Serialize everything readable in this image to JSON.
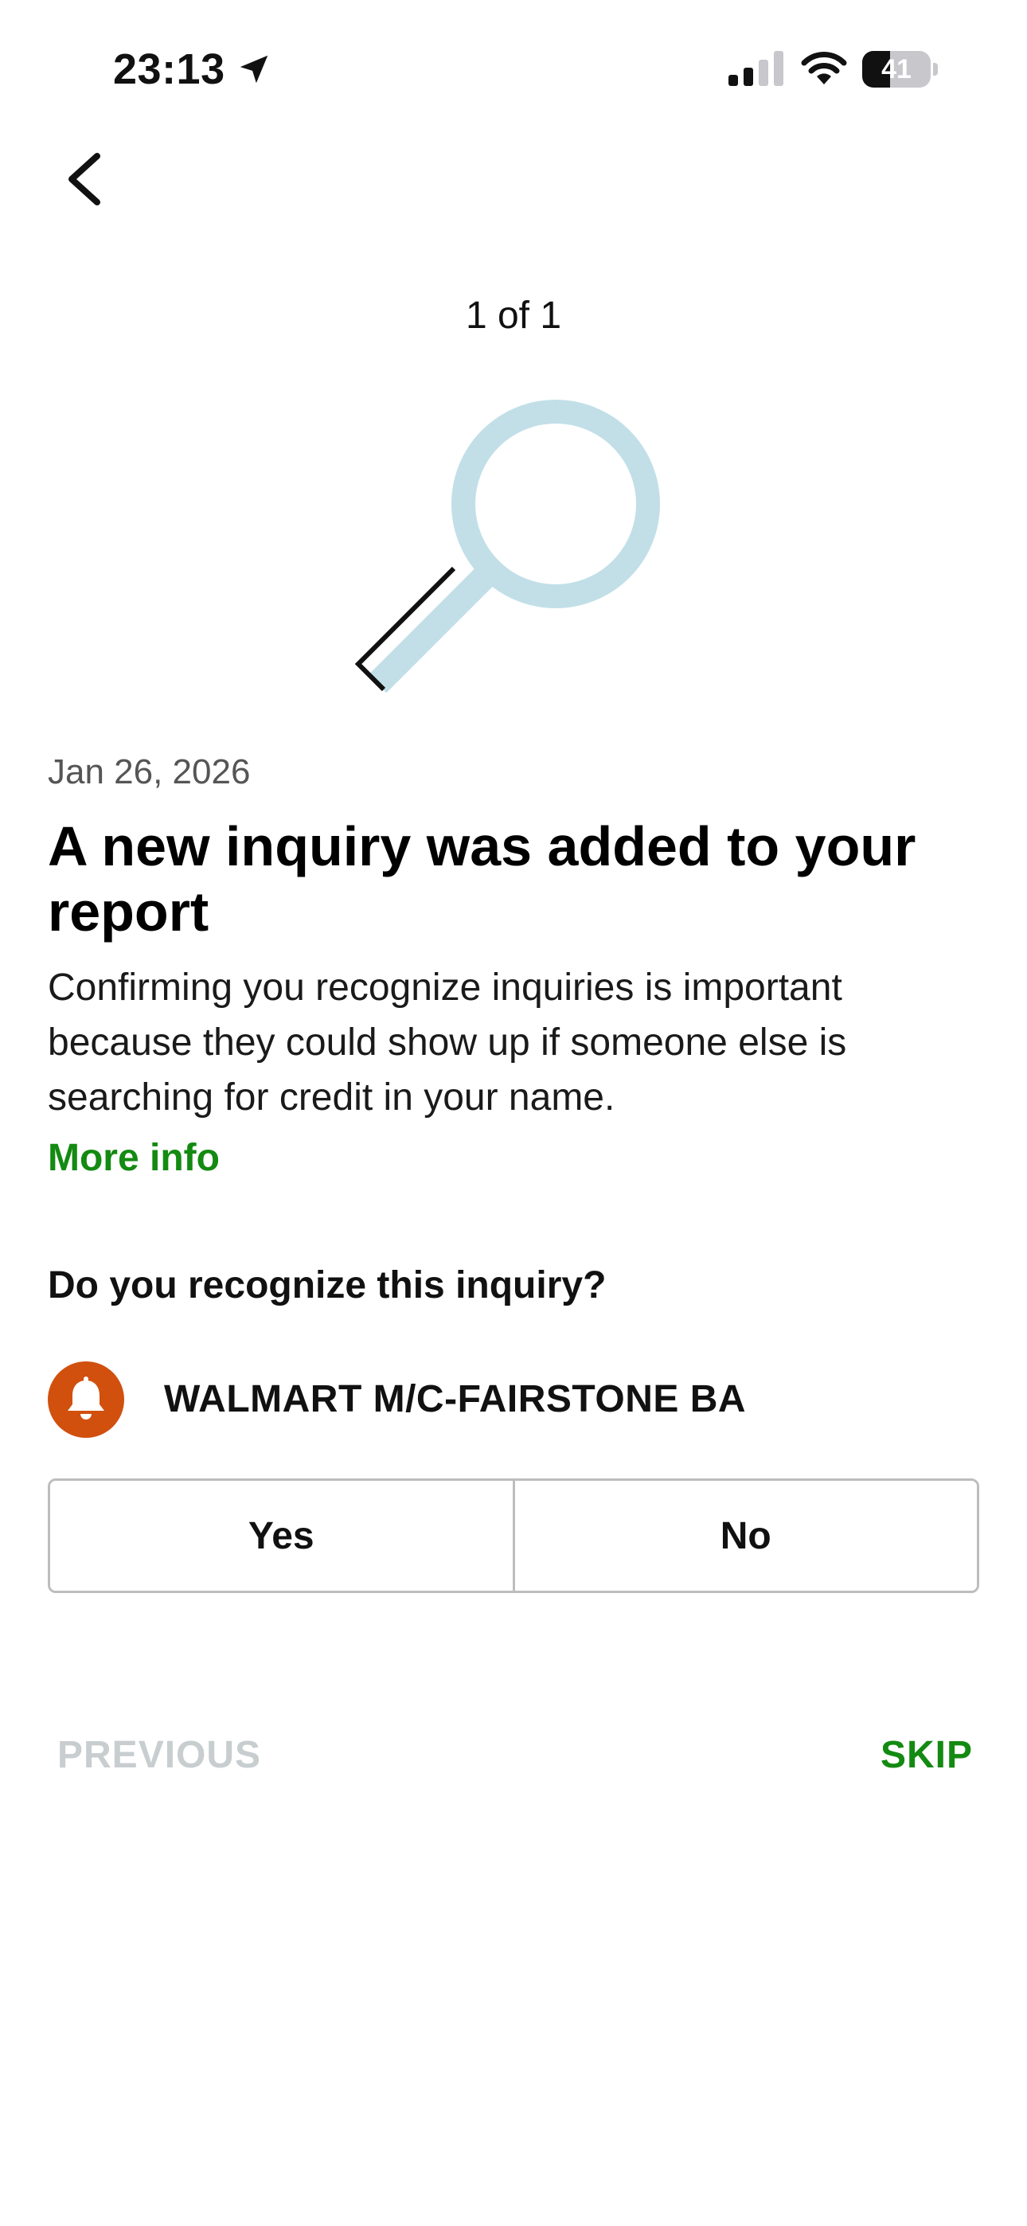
{
  "status_bar": {
    "time": "23:13",
    "location_icon": "location-arrow-icon",
    "signal_icon": "cellular-signal-icon",
    "signal_bars_active": 2,
    "signal_bars_total": 4,
    "wifi_icon": "wifi-icon",
    "battery_icon": "battery-icon",
    "battery_level": "41"
  },
  "nav": {
    "back_icon": "chevron-left-icon"
  },
  "pager": {
    "label": "1 of 1"
  },
  "hero": {
    "icon": "magnifying-glass-icon",
    "color": "#c2dfe8"
  },
  "inquiry": {
    "date": "Jan 26, 2026",
    "headline": "A new inquiry was added to your report",
    "description": "Confirming you recognize inquiries is important because they could show up if someone else is searching for credit in your name.",
    "more_info_label": "More info",
    "question": "Do you recognize this inquiry?",
    "creditor_icon": "bell-icon",
    "creditor_name": "WALMART M/C-FAIRSTONE BA"
  },
  "choices": {
    "yes_label": "Yes",
    "no_label": "No"
  },
  "footer": {
    "previous_label": "PREVIOUS",
    "skip_label": "SKIP"
  },
  "colors": {
    "accent_green": "#138a11",
    "bell_orange": "#d1500e",
    "disabled_gray": "#c8cdd0",
    "border_gray": "#bdbdbd"
  }
}
